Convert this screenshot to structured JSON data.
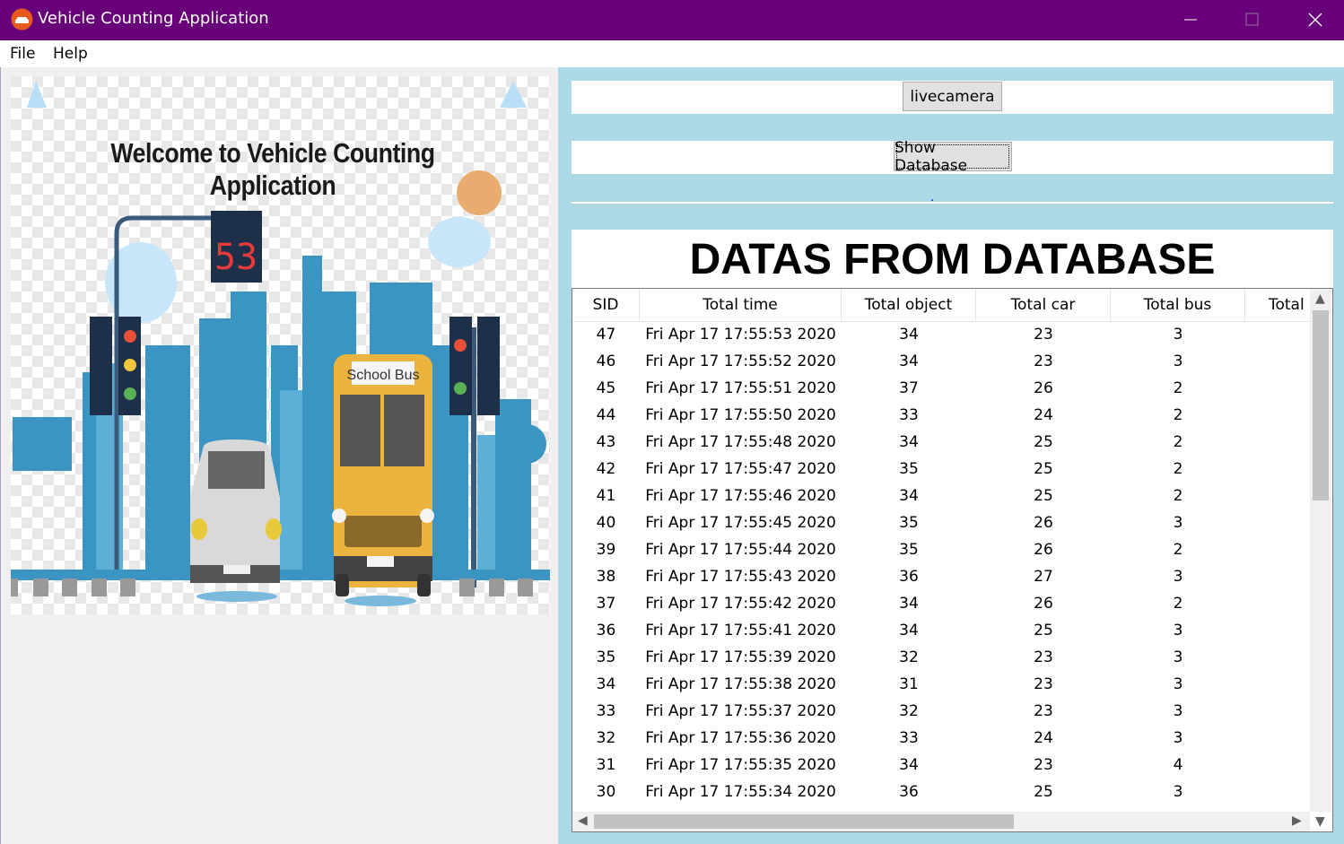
{
  "window": {
    "title": "Vehicle Counting Application",
    "colors": {
      "titlebar": "#68007a",
      "panel_bg": "#add8e6"
    }
  },
  "menu": {
    "items": [
      "File",
      "Help"
    ]
  },
  "welcome": {
    "text": "Welcome to Vehicle Counting Application",
    "traffic_display": "53",
    "bus_sign": "School Bus"
  },
  "buttons": {
    "livecamera": "livecamera",
    "show_database": "Show Database"
  },
  "status": {
    "text": "."
  },
  "database": {
    "title": "DATAS FROM DATABASE",
    "columns": [
      "SID",
      "Total time",
      "Total object",
      "Total car",
      "Total bus",
      "Total p"
    ],
    "rows": [
      [
        "47",
        "Fri Apr 17 17:55:53 2020",
        "34",
        "23",
        "3"
      ],
      [
        "46",
        "Fri Apr 17 17:55:52 2020",
        "34",
        "23",
        "3"
      ],
      [
        "45",
        "Fri Apr 17 17:55:51 2020",
        "37",
        "26",
        "2"
      ],
      [
        "44",
        "Fri Apr 17 17:55:50 2020",
        "33",
        "24",
        "2"
      ],
      [
        "43",
        "Fri Apr 17 17:55:48 2020",
        "34",
        "25",
        "2"
      ],
      [
        "42",
        "Fri Apr 17 17:55:47 2020",
        "35",
        "25",
        "2"
      ],
      [
        "41",
        "Fri Apr 17 17:55:46 2020",
        "34",
        "25",
        "2"
      ],
      [
        "40",
        "Fri Apr 17 17:55:45 2020",
        "35",
        "26",
        "3"
      ],
      [
        "39",
        "Fri Apr 17 17:55:44 2020",
        "35",
        "26",
        "2"
      ],
      [
        "38",
        "Fri Apr 17 17:55:43 2020",
        "36",
        "27",
        "3"
      ],
      [
        "37",
        "Fri Apr 17 17:55:42 2020",
        "34",
        "26",
        "2"
      ],
      [
        "36",
        "Fri Apr 17 17:55:41 2020",
        "34",
        "25",
        "3"
      ],
      [
        "35",
        "Fri Apr 17 17:55:39 2020",
        "32",
        "23",
        "3"
      ],
      [
        "34",
        "Fri Apr 17 17:55:38 2020",
        "31",
        "23",
        "3"
      ],
      [
        "33",
        "Fri Apr 17 17:55:37 2020",
        "32",
        "23",
        "3"
      ],
      [
        "32",
        "Fri Apr 17 17:55:36 2020",
        "33",
        "24",
        "3"
      ],
      [
        "31",
        "Fri Apr 17 17:55:35 2020",
        "34",
        "23",
        "4"
      ],
      [
        "30",
        "Fri Apr 17 17:55:34 2020",
        "36",
        "25",
        "3"
      ]
    ]
  },
  "icons": {
    "app": "car-logo-icon",
    "minimize": "minimize-icon",
    "maximize": "maximize-icon",
    "close": "close-icon",
    "scroll_up": "chevron-up-icon",
    "scroll_down": "chevron-down-icon",
    "scroll_left": "chevron-left-icon",
    "scroll_right": "chevron-right-icon"
  }
}
